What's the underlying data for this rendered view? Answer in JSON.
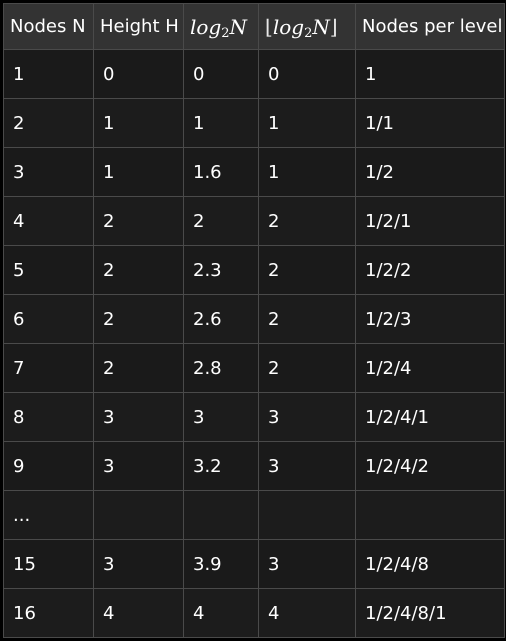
{
  "headers": {
    "nodes": "Nodes N",
    "height": "Height H",
    "log_base": "log",
    "log_sub": "2",
    "log_var": "N",
    "floor_left": "⌊",
    "floor_right": "⌋",
    "per_level": "Nodes per level"
  },
  "rows": [
    {
      "n": "1",
      "h": "0",
      "log": "0",
      "floor": "0",
      "per_level": "1"
    },
    {
      "n": "2",
      "h": "1",
      "log": "1",
      "floor": "1",
      "per_level": "1/1"
    },
    {
      "n": "3",
      "h": "1",
      "log": "1.6",
      "floor": "1",
      "per_level": "1/2"
    },
    {
      "n": "4",
      "h": "2",
      "log": "2",
      "floor": "2",
      "per_level": "1/2/1"
    },
    {
      "n": "5",
      "h": "2",
      "log": "2.3",
      "floor": "2",
      "per_level": "1/2/2"
    },
    {
      "n": "6",
      "h": "2",
      "log": "2.6",
      "floor": "2",
      "per_level": "1/2/3"
    },
    {
      "n": "7",
      "h": "2",
      "log": "2.8",
      "floor": "2",
      "per_level": "1/2/4"
    },
    {
      "n": "8",
      "h": "3",
      "log": "3",
      "floor": "3",
      "per_level": "1/2/4/1"
    },
    {
      "n": "9",
      "h": "3",
      "log": "3.2",
      "floor": "3",
      "per_level": "1/2/4/2"
    },
    {
      "n": "...",
      "h": "",
      "log": "",
      "floor": "",
      "per_level": ""
    },
    {
      "n": "15",
      "h": "3",
      "log": "3.9",
      "floor": "3",
      "per_level": "1/2/4/8"
    },
    {
      "n": "16",
      "h": "4",
      "log": "4",
      "floor": "4",
      "per_level": "1/2/4/8/1"
    }
  ]
}
